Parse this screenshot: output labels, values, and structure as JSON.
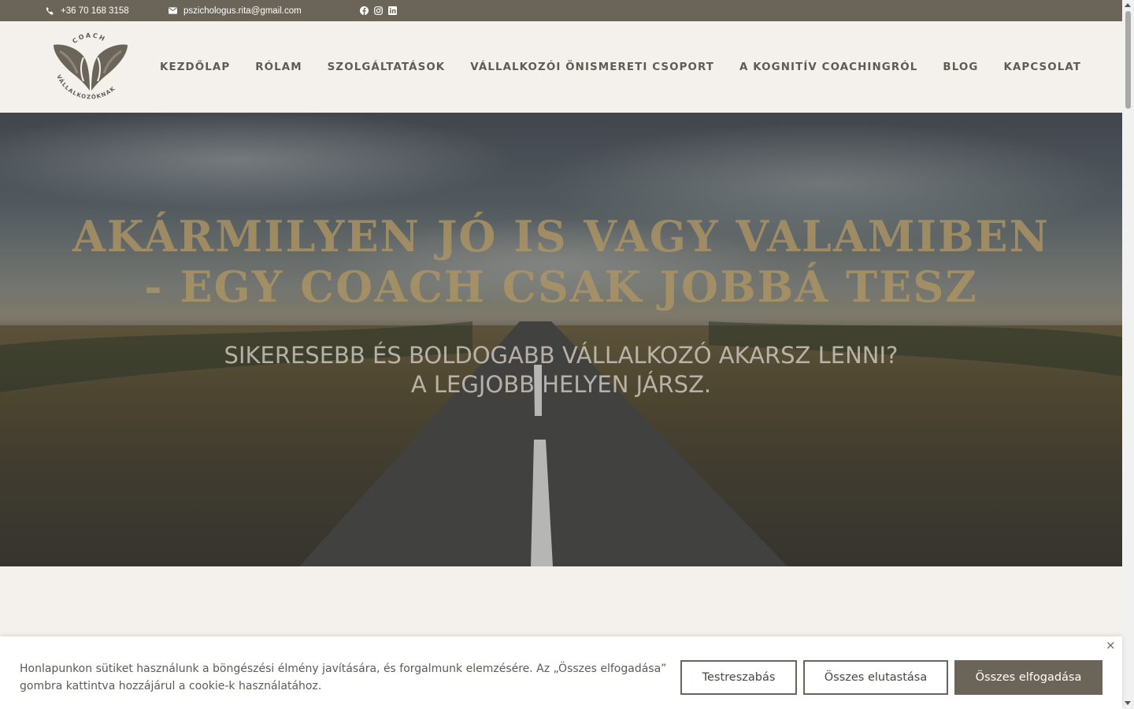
{
  "topbar": {
    "phone": "+36 70 168 3158",
    "email": "pszichologus.rita@gmail.com",
    "icons": [
      "phone-icon",
      "envelope-icon",
      "facebook-icon",
      "instagram-icon",
      "linkedin-icon"
    ]
  },
  "logo": {
    "text_top": "COACH",
    "text_bottom": "VÁLLALKOZÓKNAK"
  },
  "nav": {
    "items": [
      {
        "label": "KEZDŐLAP"
      },
      {
        "label": "RÓLAM"
      },
      {
        "label": "SZOLGÁLTATÁSOK"
      },
      {
        "label": "VÁLLALKOZÓI ÖNISMERETI CSOPORT"
      },
      {
        "label": "A KOGNITÍV COACHINGRÓL"
      },
      {
        "label": "BLOG"
      },
      {
        "label": "KAPCSOLAT"
      }
    ]
  },
  "hero": {
    "headline_line1": "AKÁRMILYEN JÓ IS VAGY VALAMIBEN",
    "headline_line2": "- EGY COACH CSAK JOBBÁ TESZ",
    "sub_line1": "SIKERESEBB ÉS BOLDOGABB VÁLLALKOZÓ AKARSZ LENNI?",
    "sub_line2": "A LEGJOBB HELYEN JÁRSZ."
  },
  "cookie": {
    "text": "Honlapunkon sütiket használunk a böngészési élmény javítására, és forgalmunk elemzésére. Az „Összes elfogadása” gombra kattintva hozzájárul a cookie-k használatához.",
    "customize_label": "Testreszabás",
    "reject_label": "Összes elutastása",
    "accept_label": "Összes elfogadása",
    "close_label": "×"
  },
  "colors": {
    "topbar": "#6b6459",
    "header_bg": "#f4f1ed",
    "nav_text": "#5f5a53",
    "headline": "#b0966a",
    "accept_button": "#6b6459"
  }
}
